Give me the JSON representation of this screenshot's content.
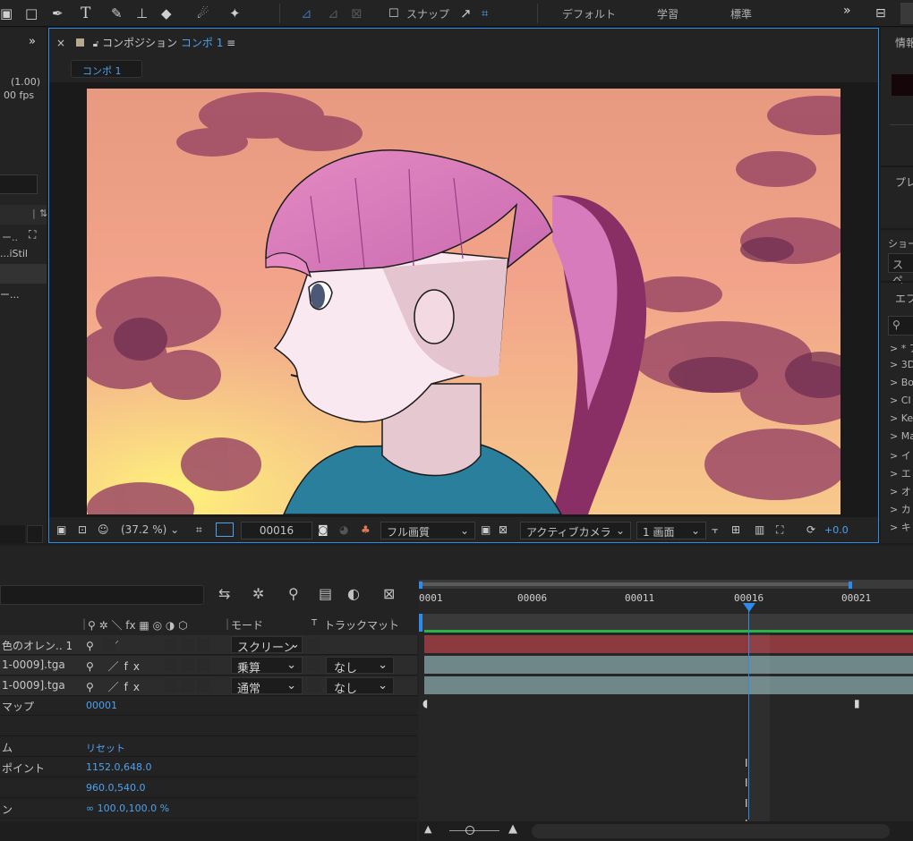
{
  "toolbar": {
    "snap_label": "スナップ",
    "workspaces": [
      "デフォルト",
      "学習",
      "標準"
    ],
    "more": "»"
  },
  "left_panel": {
    "scale": "(1.00)",
    "fps": "00 fps",
    "item1": "...iStil",
    "item2": "ー..."
  },
  "composition": {
    "close": "×",
    "tab_prefix": "コンポジション",
    "tab_name": "コンポ 1",
    "tab_menu": "≡",
    "breadcrumb": "コンポ 1",
    "zoom": "(37.2 %)",
    "timecode": "00016",
    "quality": "フル画質",
    "camera": "アクティブカメラ",
    "views": "1 画面",
    "exposure": "+0.0"
  },
  "right_panel": {
    "header": "情報",
    "preview": "プレ",
    "shortcut_label": "ショー",
    "shortcut_value": "スペ",
    "effects": "エフ",
    "search_icon": "search-icon",
    "items": [
      "> * ア",
      "> 3D",
      "> Bo",
      "> CI",
      "> Ke",
      "> Ma",
      "> イ",
      "> エ",
      "> オ",
      "> カ",
      "> キ"
    ]
  },
  "timeline": {
    "ruler": [
      "0001",
      "00006",
      "00011",
      "00016",
      "00021"
    ],
    "header": {
      "switches": "⚲ ✲ ＼ fx ▦ ◎ ◑ ⬡",
      "mode": "モード",
      "t": "T",
      "trackmatte": "トラックマット"
    },
    "layers": [
      {
        "name": "色のオレン.. 1",
        "switches": "⚲   ／",
        "mode": "スクリーン",
        "trackmatte": ""
      },
      {
        "name": "1-0009].tga",
        "switches": "⚲   ／fx",
        "mode": "乗算",
        "trackmatte": "なし"
      },
      {
        "name": "1-0009].tga",
        "switches": "⚲   ／fx",
        "mode": "通常",
        "trackmatte": "なし"
      }
    ],
    "properties": [
      {
        "name": "マップ",
        "value": "00001"
      },
      {
        "name": "",
        "value": ""
      },
      {
        "name": "ム",
        "value": "リセット"
      },
      {
        "name": "ポイント",
        "value": "1152.0,648.0"
      },
      {
        "name": "",
        "value": "960.0,540.0"
      },
      {
        "name": "ン",
        "value": "∞ 100.0,100.0 %"
      }
    ]
  },
  "colors": {
    "accent": "#2d8ceb",
    "link": "#4ea1ef",
    "layer_red": "#8c3a3f",
    "layer_teal": "#6f8788",
    "green": "#2bb34a",
    "bg": "#232323"
  }
}
